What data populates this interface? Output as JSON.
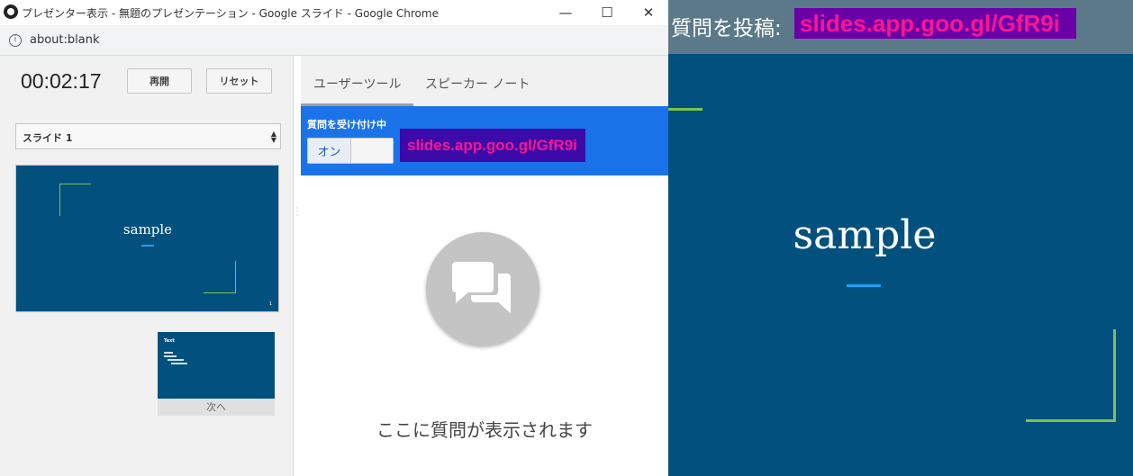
{
  "slideshow": {
    "question_prefix": "質問を投稿:",
    "question_url": "slides.app.goo.gl/GfR9i",
    "slide_title": "sample",
    "colors": {
      "background": "#01507e",
      "accent_line": "#1da1f2",
      "corner": "#7dc24b"
    }
  },
  "window": {
    "title": "プレゼンター表示 - 無題のプレゼンテーション - Google スライド - Google Chrome",
    "address": "about:blank",
    "controls": {
      "minimize": "—",
      "maximize": "☐",
      "close": "✕"
    }
  },
  "presenter": {
    "timer": "00:02:17",
    "resume_label": "再開",
    "reset_label": "リセット",
    "slide_select": "スライド 1",
    "current_thumb_title": "sample",
    "current_thumb_number": "1",
    "next_thumb_title": "Text",
    "next_label": "次へ"
  },
  "tools": {
    "tabs": [
      "ユーザーツール",
      "スピーカー ノート"
    ],
    "qa_label": "質問を受け付け中",
    "toggle_on": "オン",
    "qa_url": "slides.app.goo.gl/GfR9i",
    "empty_text": "ここに質問が表示されます"
  }
}
